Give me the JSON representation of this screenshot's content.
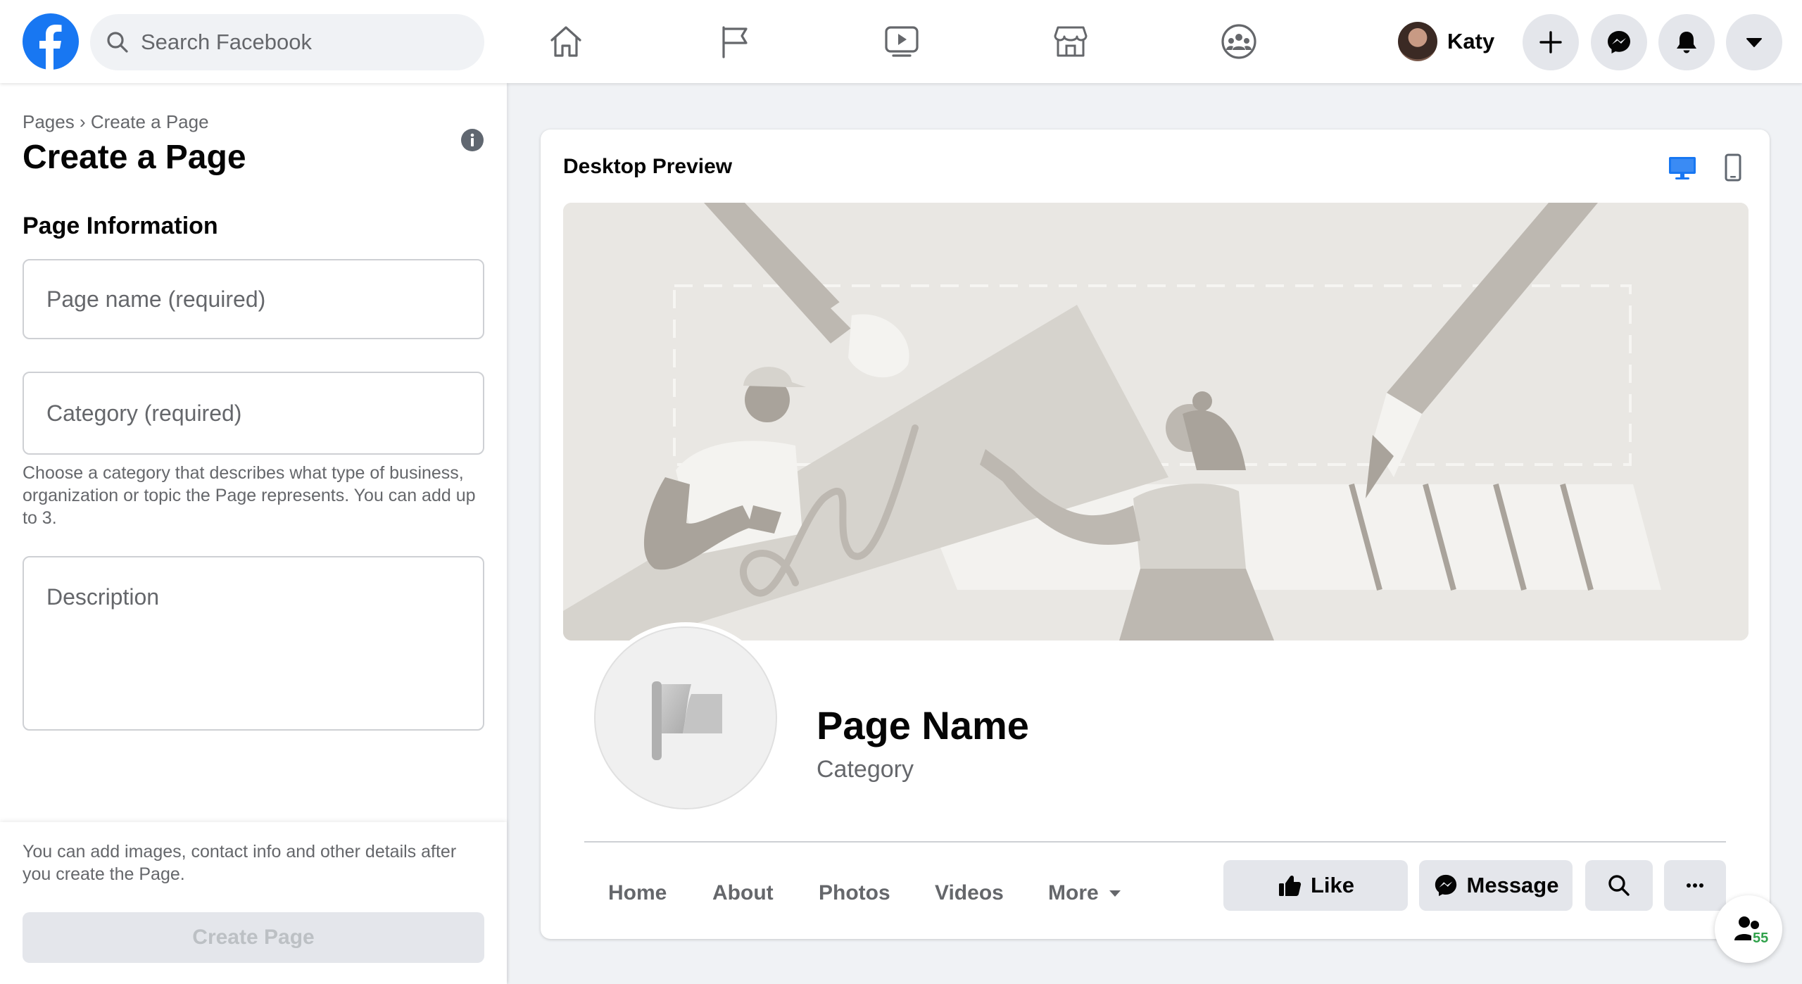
{
  "topbar": {
    "search_placeholder": "Search Facebook",
    "nav": [
      {
        "name": "home",
        "icon": "home-icon"
      },
      {
        "name": "pages",
        "icon": "flag-icon"
      },
      {
        "name": "watch",
        "icon": "video-icon"
      },
      {
        "name": "marketplace",
        "icon": "store-icon"
      },
      {
        "name": "groups",
        "icon": "groups-icon"
      }
    ],
    "profile_name": "Katy"
  },
  "left_panel": {
    "breadcrumb": {
      "parent": "Pages",
      "separator": "›",
      "current": "Create a Page"
    },
    "title": "Create a Page",
    "section_title": "Page Information",
    "page_name_placeholder": "Page name (required)",
    "category_placeholder": "Category (required)",
    "category_help": "Choose a category that describes what type of business, organization or topic the Page represents. You can add up to 3.",
    "description_placeholder": "Description",
    "footer_text": "You can add images, contact info and other details after you create the Page.",
    "create_button": "Create Page"
  },
  "preview": {
    "title": "Desktop Preview",
    "page_name": "Page Name",
    "category": "Category",
    "tabs": [
      "Home",
      "About",
      "Photos",
      "Videos",
      "More"
    ],
    "actions": {
      "like": "Like",
      "message": "Message"
    }
  },
  "contacts_count": "55",
  "colors": {
    "brand_blue": "#1877f2",
    "text_primary": "#050505",
    "text_secondary": "#65676b",
    "button_gray": "#e4e6eb",
    "page_bg": "#f0f2f5",
    "online_green": "#31a24c"
  }
}
